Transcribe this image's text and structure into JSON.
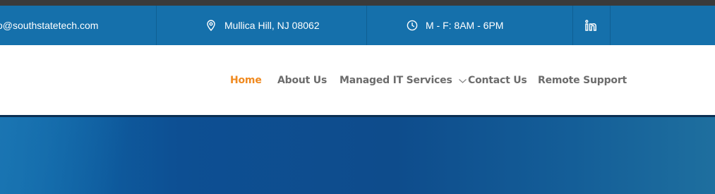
{
  "topbar": {
    "email": "o@southstatetech.com",
    "location": "Mullica Hill, NJ 08062",
    "hours": "M - F: 8AM - 6PM",
    "social_icon": "linkedin-icon"
  },
  "nav": {
    "items": [
      {
        "label": "Home",
        "active": true
      },
      {
        "label": "About Us"
      },
      {
        "label": "Managed IT Services",
        "has_dropdown": true
      },
      {
        "label": "Contact Us"
      },
      {
        "label": "Remote Support"
      }
    ]
  },
  "colors": {
    "topbar_bg": "#1570ab",
    "active_nav": "#f08a20",
    "nav_text": "#6c6c6c",
    "hero_blue": "#0e4c8c"
  }
}
